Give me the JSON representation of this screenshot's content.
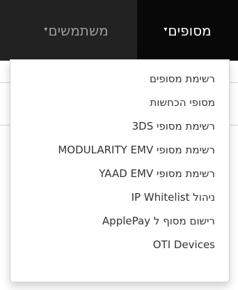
{
  "navbar": {
    "terminals_label": "מסופים",
    "users_label": "משתמשים",
    "caret": "▾"
  },
  "dropdown": {
    "items": [
      "רשימת מסופים",
      "מסופי הכחשות",
      "רשימת מסופי 3DS",
      "רשימת מסופי MODULARITY EMV",
      "רשימת מסופי YAAD EMV",
      "ניהול IP Whitelist",
      "רישום מסוף ל ApplePay",
      "OTI Devices"
    ]
  },
  "colors": {
    "navbar_bg": "#222222",
    "active_bg": "#080808",
    "active_text": "#ffffff",
    "inactive_text": "#9d9d9d",
    "menu_text": "#333333"
  }
}
